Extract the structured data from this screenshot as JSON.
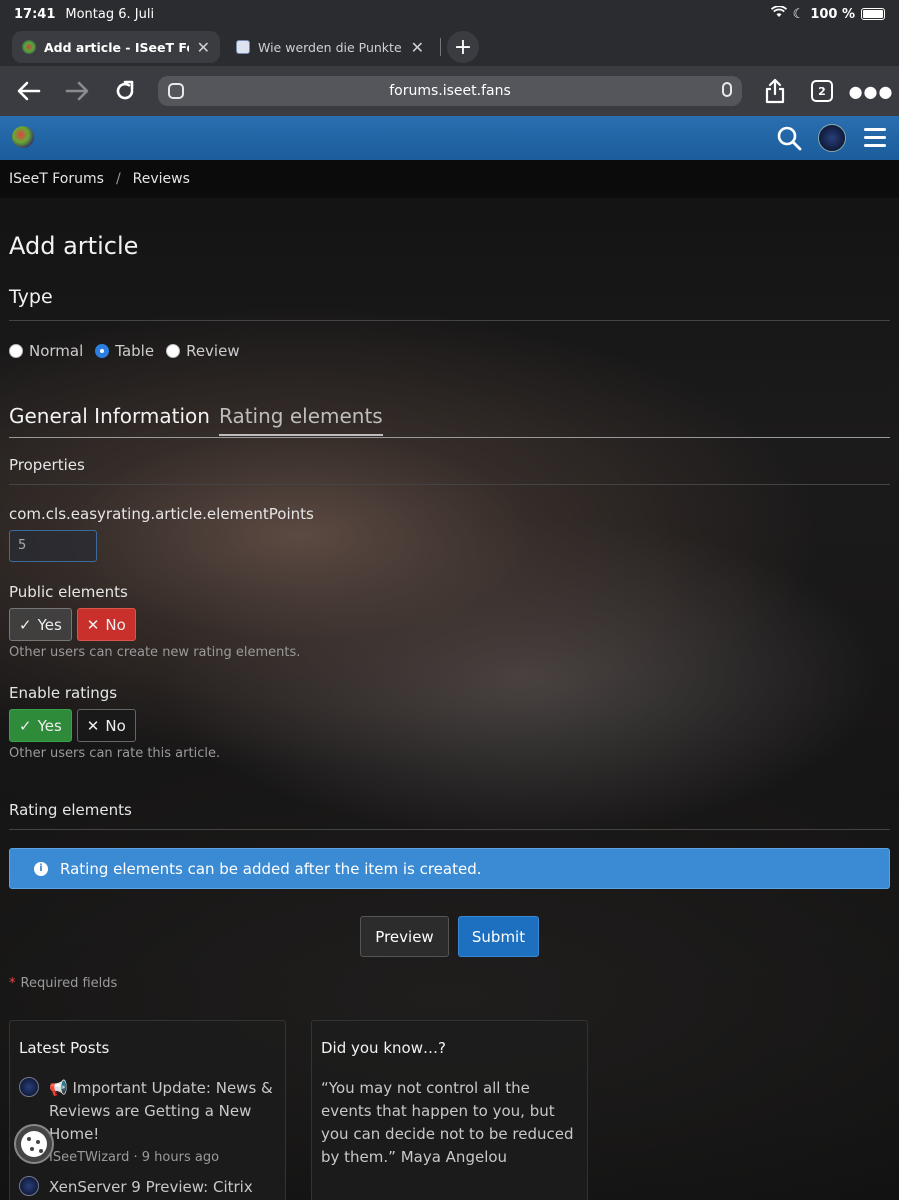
{
  "status_bar": {
    "time": "17:41",
    "date": "Montag 6. Juli",
    "battery": "100 %"
  },
  "browser": {
    "tabs": [
      {
        "title": "Add article - ISeeT Foru",
        "active": true
      },
      {
        "title": "Wie werden die Punkte",
        "active": false
      }
    ],
    "url": "forums.iseet.fans",
    "tab_count": "2"
  },
  "breadcrumb": [
    "ISeeT Forums",
    "Reviews"
  ],
  "page": {
    "title": "Add article",
    "type_section": "Type",
    "type_options": [
      {
        "label": "Normal",
        "selected": false
      },
      {
        "label": "Table",
        "selected": true
      },
      {
        "label": "Review",
        "selected": false
      }
    ],
    "tabs": [
      "General Information",
      "Rating elements"
    ],
    "properties_header": "Properties",
    "element_points_label": "com.cls.easyrating.article.elementPoints",
    "element_points_value": "5",
    "public_elements": {
      "label": "Public elements",
      "yes": "Yes",
      "no": "No",
      "selected": "no",
      "hint": "Other users can create new rating elements."
    },
    "enable_ratings": {
      "label": "Enable ratings",
      "yes": "Yes",
      "no": "No",
      "selected": "yes",
      "hint": "Other users can rate this article."
    },
    "rating_elements_header": "Rating elements",
    "info_message": "Rating elements can be added after the item is created.",
    "preview_label": "Preview",
    "submit_label": "Submit",
    "required_star": "*",
    "required_text": "Required fields"
  },
  "widgets": {
    "latest_posts": {
      "title": "Latest Posts",
      "posts": [
        {
          "title": "📢 Important Update: News & Reviews are Getting a New Home!",
          "author": "ISeeTWizard",
          "time": "9 hours ago"
        },
        {
          "title": "XenServer 9 Preview: Citrix"
        }
      ]
    },
    "did_you_know": {
      "title": "Did you know…?",
      "quote": "“You may not control all the events that happen to you, but you can decide not to be reduced by them.” Maya Angelou"
    }
  },
  "colors": {
    "header_blue": "#1b5d9c",
    "info_blue": "#3a8bd3",
    "danger": "#c9302c",
    "success": "#2e8b3a",
    "submit": "#1d6fc0"
  }
}
